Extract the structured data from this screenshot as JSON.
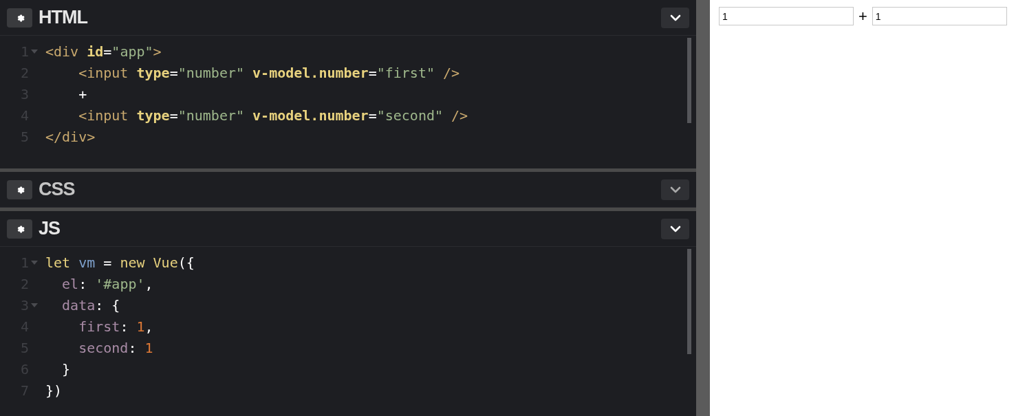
{
  "panels": [
    {
      "title": "HTML",
      "expanded": true,
      "lines": [
        {
          "number": "1",
          "foldable": true,
          "tokens": [
            {
              "kind": "tag",
              "text": "<div"
            },
            {
              "kind": "attr",
              "text": " id"
            },
            {
              "kind": "plain",
              "text": "="
            },
            {
              "kind": "string",
              "text": "\"app\""
            },
            {
              "kind": "tag",
              "text": ">"
            }
          ]
        },
        {
          "number": "2",
          "foldable": false,
          "tokens": [
            {
              "kind": "tag",
              "text": "    <input"
            },
            {
              "kind": "attr",
              "text": " type"
            },
            {
              "kind": "plain",
              "text": "="
            },
            {
              "kind": "string",
              "text": "\"number\""
            },
            {
              "kind": "attr",
              "text": " v-model.number"
            },
            {
              "kind": "plain",
              "text": "="
            },
            {
              "kind": "string",
              "text": "\"first\""
            },
            {
              "kind": "tag",
              "text": " />"
            }
          ]
        },
        {
          "number": "3",
          "foldable": false,
          "tokens": [
            {
              "kind": "plain",
              "text": "    +"
            }
          ]
        },
        {
          "number": "4",
          "foldable": false,
          "tokens": [
            {
              "kind": "tag",
              "text": "    <input"
            },
            {
              "kind": "attr",
              "text": " type"
            },
            {
              "kind": "plain",
              "text": "="
            },
            {
              "kind": "string",
              "text": "\"number\""
            },
            {
              "kind": "attr",
              "text": " v-model.number"
            },
            {
              "kind": "plain",
              "text": "="
            },
            {
              "kind": "string",
              "text": "\"second\""
            },
            {
              "kind": "tag",
              "text": " />"
            }
          ]
        },
        {
          "number": "5",
          "foldable": false,
          "tokens": [
            {
              "kind": "tag",
              "text": "</div>"
            }
          ]
        }
      ]
    },
    {
      "title": "CSS",
      "expanded": false
    },
    {
      "title": "JS",
      "expanded": true,
      "lines": [
        {
          "number": "1",
          "foldable": true,
          "tokens": [
            {
              "kind": "keyword",
              "text": "let"
            },
            {
              "kind": "variable",
              "text": " vm"
            },
            {
              "kind": "plain",
              "text": " ="
            },
            {
              "kind": "keyword",
              "text": " new"
            },
            {
              "kind": "keyword",
              "text": " Vue"
            },
            {
              "kind": "plain",
              "text": "({"
            }
          ]
        },
        {
          "number": "2",
          "foldable": false,
          "tokens": [
            {
              "kind": "property",
              "text": "  el"
            },
            {
              "kind": "plain",
              "text": ":"
            },
            {
              "kind": "string",
              "text": " '#app'"
            },
            {
              "kind": "plain",
              "text": ","
            }
          ]
        },
        {
          "number": "3",
          "foldable": true,
          "tokens": [
            {
              "kind": "property",
              "text": "  data"
            },
            {
              "kind": "plain",
              "text": ": {"
            }
          ]
        },
        {
          "number": "4",
          "foldable": false,
          "tokens": [
            {
              "kind": "property",
              "text": "    first"
            },
            {
              "kind": "plain",
              "text": ":"
            },
            {
              "kind": "number",
              "text": " 1"
            },
            {
              "kind": "plain",
              "text": ","
            }
          ]
        },
        {
          "number": "5",
          "foldable": false,
          "tokens": [
            {
              "kind": "property",
              "text": "    second"
            },
            {
              "kind": "plain",
              "text": ":"
            },
            {
              "kind": "number",
              "text": " 1"
            }
          ]
        },
        {
          "number": "6",
          "foldable": false,
          "tokens": [
            {
              "kind": "plain",
              "text": "  }"
            }
          ]
        },
        {
          "number": "7",
          "foldable": false,
          "tokens": [
            {
              "kind": "plain",
              "text": "})"
            }
          ]
        }
      ]
    }
  ],
  "preview": {
    "first_input": {
      "value": "1"
    },
    "operator": "+",
    "second_input": {
      "value": "1"
    }
  }
}
